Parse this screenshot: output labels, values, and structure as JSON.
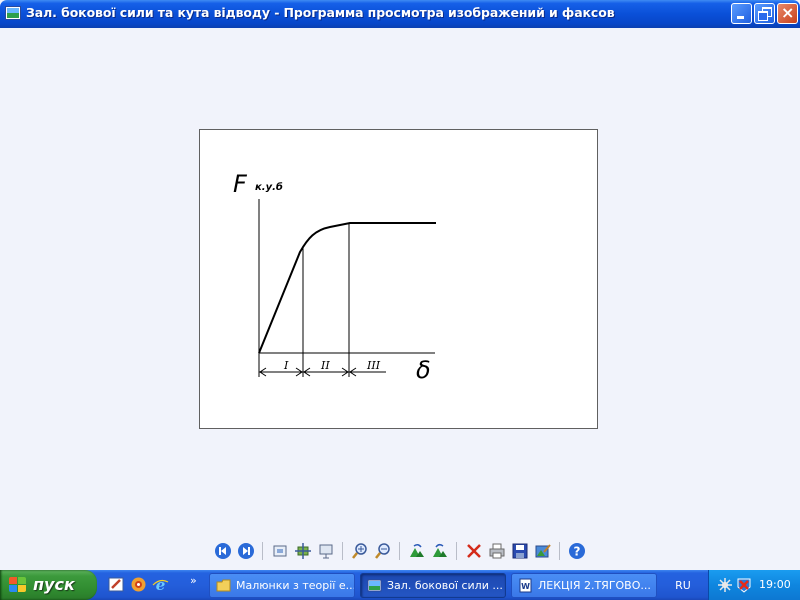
{
  "window": {
    "title": "Зал. бокової сили та кута відводу - Программа просмотра изображений и факсов",
    "buttons": {
      "minimize": "minimize",
      "maximize": "restore",
      "close": "×"
    }
  },
  "image": {
    "y_axis_label": "F",
    "y_axis_subscript": "к.у.б",
    "x_axis_label": "δ",
    "zones": [
      "I",
      "II",
      "III"
    ]
  },
  "toolbar": {
    "icons": [
      "previous-image-icon",
      "next-image-icon",
      "best-fit-icon",
      "actual-size-icon",
      "slideshow-icon",
      "zoom-in-icon",
      "zoom-out-icon",
      "rotate-clockwise-icon",
      "rotate-counterclockwise-icon",
      "delete-icon",
      "print-icon",
      "save-icon",
      "edit-icon",
      "help-icon"
    ]
  },
  "taskbar": {
    "start_label": "пуск",
    "quick_launch_more": "»",
    "tasks": [
      {
        "label": "Малюнки з теорії е...",
        "icon": "folder-icon",
        "active": false
      },
      {
        "label": "Зал. бокової сили ...",
        "icon": "image-viewer-icon",
        "active": true
      },
      {
        "label": "ЛЕКЦІЯ 2.ТЯГОВО...",
        "icon": "word-icon",
        "active": false
      }
    ],
    "language": "RU",
    "clock": "19:00"
  }
}
